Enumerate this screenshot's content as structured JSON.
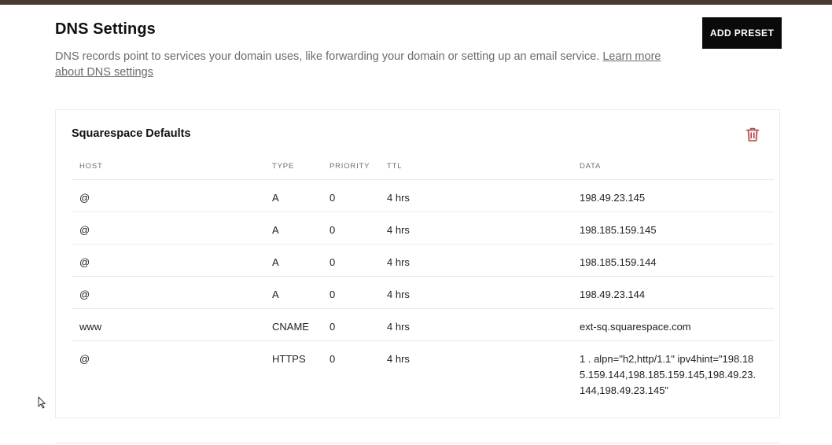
{
  "header": {
    "title": "DNS Settings",
    "add_preset_label": "ADD PRESET",
    "description": "DNS records point to services your domain uses, like forwarding your domain or setting up an email service. ",
    "learn_more_label": "Learn more about DNS settings"
  },
  "card": {
    "title": "Squarespace Defaults",
    "delete_icon": "trash-icon",
    "columns": {
      "host": "HOST",
      "type": "TYPE",
      "priority": "PRIORITY",
      "ttl": "TTL",
      "data": "DATA"
    },
    "rows": [
      {
        "host": "@",
        "type": "A",
        "priority": "0",
        "ttl": "4 hrs",
        "data": "198.49.23.145"
      },
      {
        "host": "@",
        "type": "A",
        "priority": "0",
        "ttl": "4 hrs",
        "data": "198.185.159.145"
      },
      {
        "host": "@",
        "type": "A",
        "priority": "0",
        "ttl": "4 hrs",
        "data": "198.185.159.144"
      },
      {
        "host": "@",
        "type": "A",
        "priority": "0",
        "ttl": "4 hrs",
        "data": "198.49.23.144"
      },
      {
        "host": "www",
        "type": "CNAME",
        "priority": "0",
        "ttl": "4 hrs",
        "data": "ext-sq.squarespace.com"
      },
      {
        "host": "@",
        "type": "HTTPS",
        "priority": "0",
        "ttl": "4 hrs",
        "data": "1 . alpn=\"h2,http/1.1\" ipv4hint=\"198.185.159.144,198.185.159.145,198.49.23.144,198.49.23.145\""
      }
    ]
  },
  "colors": {
    "top_bar": "#4a3a33",
    "button_bg": "#0a0a0a",
    "delete_red": "#d0393b",
    "muted_text": "#6b6b6b"
  }
}
